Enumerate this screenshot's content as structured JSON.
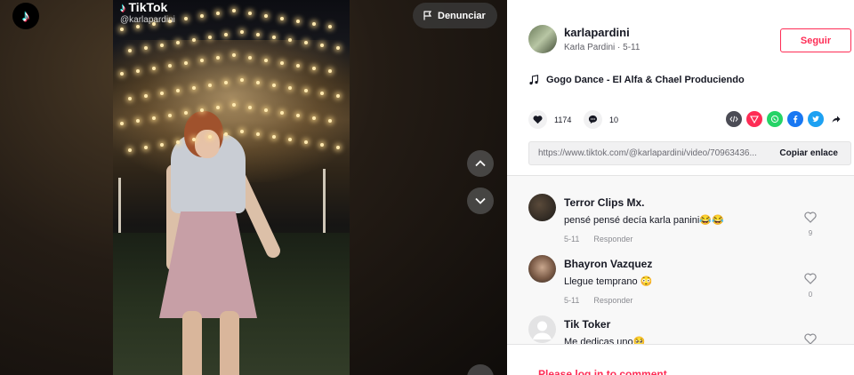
{
  "brand": {
    "logo_icon": "tiktok-logo-icon",
    "watermark": "TikTok",
    "watermark_user": "@karlapardini"
  },
  "video": {
    "report_label": "Denunciar",
    "report_icon": "flag-icon",
    "prev_icon": "chevron-up-icon",
    "next_icon": "chevron-down-icon"
  },
  "author": {
    "username": "karlapardini",
    "display_name": "Karla Pardini",
    "date": "5-11",
    "follow_label": "Seguir"
  },
  "music": {
    "icon": "music-note-icon",
    "title": "Gogo Dance - El Alfa & Chael Produciendo"
  },
  "stats": {
    "likes": "1174",
    "comments": "10"
  },
  "share": {
    "icons": [
      "embed-icon",
      "direct-send-icon",
      "whatsapp-icon",
      "facebook-icon",
      "twitter-icon",
      "share-arrow-icon"
    ]
  },
  "link": {
    "url": "https://www.tiktok.com/@karlapardini/video/70963436...",
    "copy_label": "Copiar enlace"
  },
  "comments": [
    {
      "user": "Terror Clips Mx.",
      "text": "pensé pensé decía karla panini😂😂",
      "date": "5-11",
      "reply": "Responder",
      "likes": "9"
    },
    {
      "user": "Bhayron Vazquez",
      "text": "Llegue temprano 😳",
      "date": "5-11",
      "reply": "Responder",
      "likes": "0"
    },
    {
      "user": "Tik Toker",
      "text": "Me dedicas uno🥺",
      "date": "",
      "reply": "",
      "likes": ""
    }
  ],
  "login_prompt": "Please log in to comment",
  "colors": {
    "accent": "#fe2c55",
    "panel_bg": "#ffffff",
    "comments_bg": "#f8f8f8"
  }
}
